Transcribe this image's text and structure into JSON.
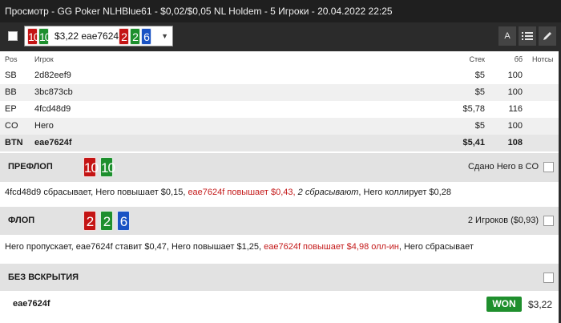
{
  "window": {
    "title": "Просмотр - GG Poker NLHBlue61 - $0,02/$0,05 NL Holdem - 5 Игроки - 20.04.2022 22:25"
  },
  "toolbar": {
    "hand_select": {
      "hole_cards": [
        "10",
        "10"
      ],
      "amount": "$3,22 eae7624f",
      "board_cards": [
        "2",
        "2",
        "6"
      ]
    },
    "font_button_label": "A",
    "list_button_icon": "list-icon",
    "edit_button_icon": "pencil-icon"
  },
  "players": {
    "headers": {
      "pos": "Pos",
      "name": "Игрок",
      "stack": "Стек",
      "bb": "бб",
      "notes": "Нотсы"
    },
    "rows": [
      {
        "pos": "SB",
        "name": "2d82eef9",
        "stack": "$5",
        "bb": "100"
      },
      {
        "pos": "BB",
        "name": "3bc873cb",
        "stack": "$5",
        "bb": "100"
      },
      {
        "pos": "EP",
        "name": "4fcd48d9",
        "stack": "$5,78",
        "bb": "116"
      },
      {
        "pos": "CO",
        "name": "Hero",
        "stack": "$5",
        "bb": "100"
      },
      {
        "pos": "BTN",
        "name": "eae7624f",
        "stack": "$5,41",
        "bb": "108"
      }
    ]
  },
  "preflop": {
    "title": "ПРЕФЛОП",
    "cards": [
      "10",
      "10"
    ],
    "right_text": "Сдано Hero в CO",
    "actions": {
      "a1": "4fcd48d9 сбрасывает, Hero повышает $0,15, ",
      "a2": "eae7624f повышает $0,43, ",
      "a3": "2 сбрасывают",
      "a4": ", Hero коллирует $0,28"
    }
  },
  "flop": {
    "title": "ФЛОП",
    "cards": [
      "2",
      "2",
      "6"
    ],
    "right_text": "2 Игроков ($0,93)",
    "actions": {
      "a1": "Hero пропускает, eae7624f ставит $0,47, Hero повышает $1,25, ",
      "a2": "eae7624f повышает $4,98 олл-ин",
      "a3": ", Hero сбрасывает"
    }
  },
  "showdown": {
    "title": "БЕЗ ВСКРЫТИЯ",
    "winner": "eae7624f",
    "badge": "WON",
    "amount": "$3,22"
  },
  "colors": {
    "red_card": "#c41414",
    "green_card": "#1d8f2d",
    "blue_card": "#1a53c4",
    "aggressive_action": "#c41a1a",
    "won_badge": "#1f8f2d"
  }
}
